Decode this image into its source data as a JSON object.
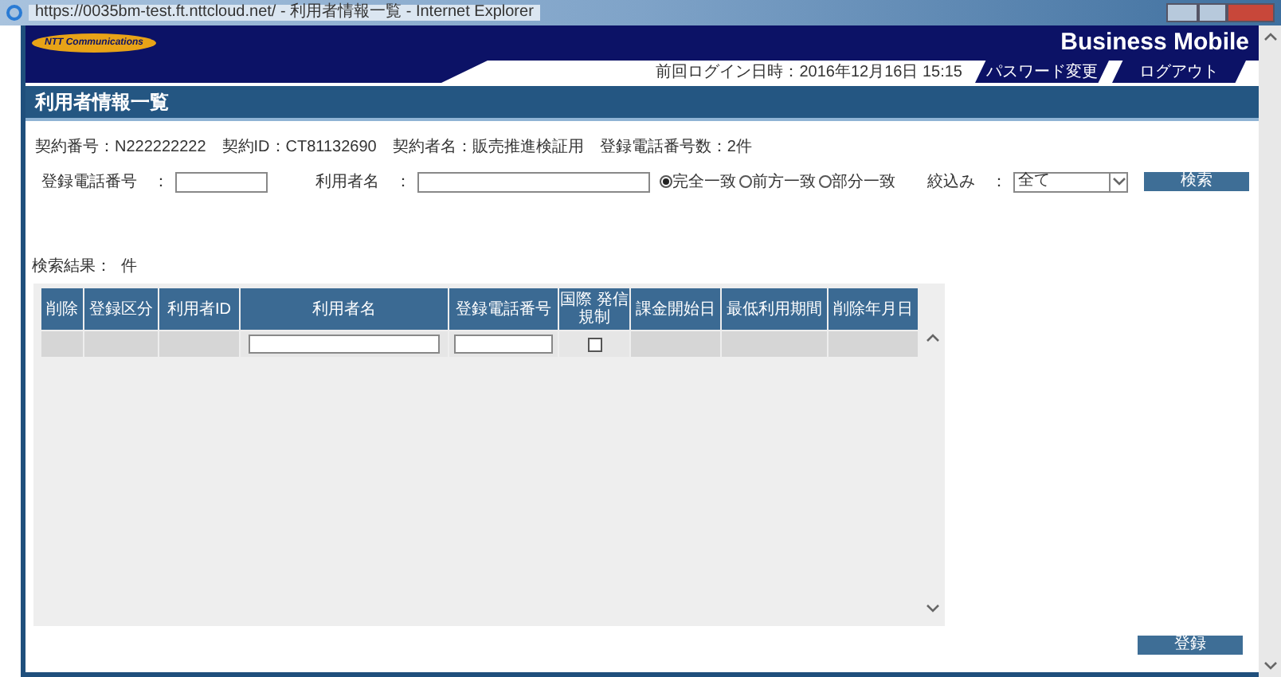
{
  "window": {
    "title": "https://0035bm-test.ft.nttcloud.net/ - 利用者情報一覧 - Internet Explorer"
  },
  "header": {
    "logo": "NTT Communications",
    "brand": "Business Mobile",
    "last_login": "前回ログイン日時：2016年12月16日 15:15",
    "nav_tabs": [
      "パスワード変更",
      "ログアウト"
    ]
  },
  "page_title": "利用者情報一覧",
  "contract_info": "契約番号：N222222222　契約ID：CT81132690　契約者名：販売推進検証用　登録電話番号数：2件",
  "search": {
    "phone_label": "登録電話番号　：",
    "name_label": "利用者名　：",
    "match_options": [
      {
        "label": "完全一致",
        "selected": true
      },
      {
        "label": "前方一致",
        "selected": false
      },
      {
        "label": "部分一致",
        "selected": false
      }
    ],
    "filter_label": "絞込み　：",
    "filter_value": "全て",
    "search_button": "検索"
  },
  "results": {
    "label": "検索結果：",
    "count": "件"
  },
  "table": {
    "columns": [
      {
        "label": "削除"
      },
      {
        "label": "登録区分"
      },
      {
        "label": "利用者ID"
      },
      {
        "label": "利用者名"
      },
      {
        "label": "登録電話番号"
      },
      {
        "label": "国際 発信規制"
      },
      {
        "label": "課金開始日"
      },
      {
        "label": "最低利用期間"
      },
      {
        "label": "削除年月日"
      }
    ],
    "rows": [
      {
        "cells": [
          {
            "kind": "empty"
          },
          {
            "kind": "empty"
          },
          {
            "kind": "empty"
          },
          {
            "kind": "input"
          },
          {
            "kind": "input"
          },
          {
            "kind": "checkbox",
            "checked": false
          },
          {
            "kind": "empty"
          },
          {
            "kind": "empty"
          },
          {
            "kind": "empty"
          }
        ]
      }
    ]
  },
  "register_button": "登録"
}
